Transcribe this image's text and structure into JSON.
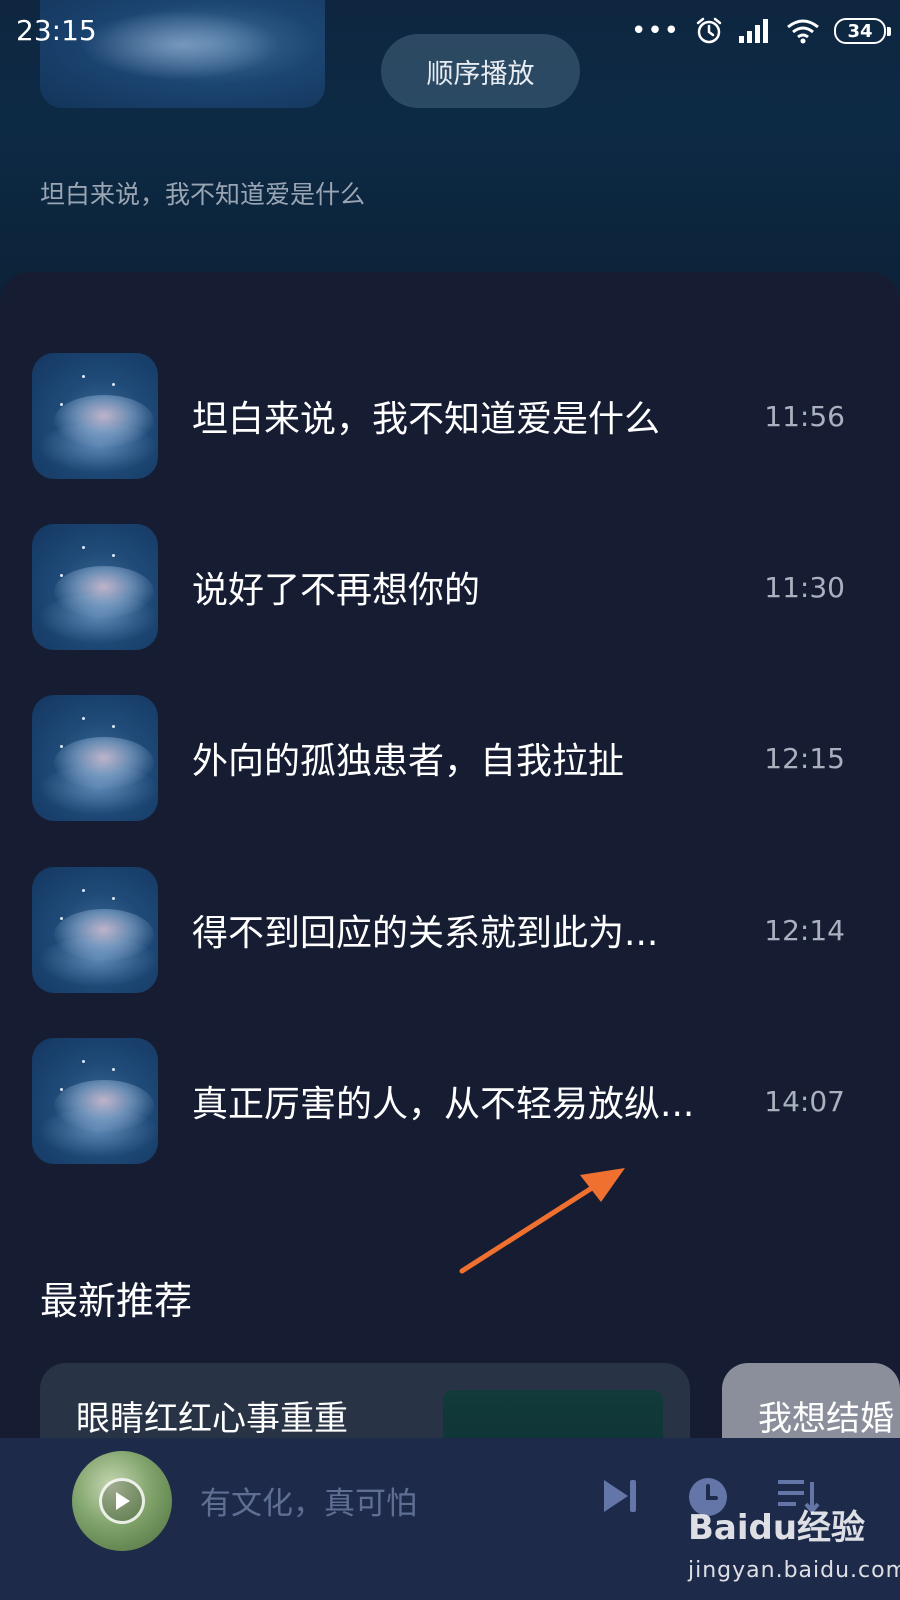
{
  "status_bar": {
    "time": "23:15",
    "battery": "34",
    "icons": [
      "more-dots-icon",
      "alarm-icon",
      "signal-icon",
      "wifi-icon",
      "battery-icon"
    ]
  },
  "header": {
    "play_order_label": "顺序播放",
    "subtitle": "坦白来说，我不知道爱是什么"
  },
  "tracks": [
    {
      "title": "坦白来说，我不知道爱是什么",
      "time": "11:56"
    },
    {
      "title": "说好了不再想你的",
      "time": "11:30"
    },
    {
      "title": "外向的孤独患者，自我拉扯",
      "time": "12:15"
    },
    {
      "title": "得不到回应的关系就到此为...",
      "time": "12:14"
    },
    {
      "title": "真正厉害的人，从不轻易放纵...",
      "time": "14:07"
    }
  ],
  "recommend": {
    "section_title": "最新推荐",
    "cards": [
      {
        "title": "眼睛红红心事重重"
      },
      {
        "title": "我想结婚"
      }
    ]
  },
  "player": {
    "now_playing": "有文化，真可怕",
    "controls": [
      "next-track-icon",
      "timer-icon",
      "playlist-icon"
    ]
  },
  "watermark": {
    "logo": "Baidu经验",
    "url": "jingyan.baidu.com"
  },
  "colors": {
    "panel_bg": "#161d33",
    "player_bg": "#1e2a4a",
    "annotation_arrow": "#f07030"
  }
}
